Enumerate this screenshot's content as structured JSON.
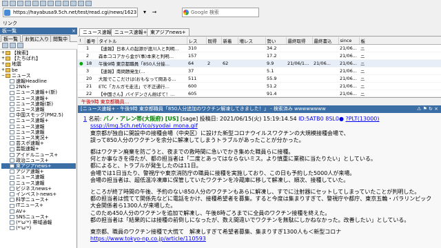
{
  "address": {
    "url": "https://hayabusa9.5ch.net/test/read.cgi/news/1623737954/",
    "search_placeholder": "Google 検索"
  },
  "linkbar": {
    "label": "リンク"
  },
  "left_panel": {
    "title": "板一覧",
    "tabs": [
      "板一覧",
      "お気に入り",
      "閲覧中"
    ],
    "tree": [
      {
        "label": "【検索】",
        "kind": "folder",
        "expander": "+"
      },
      {
        "label": "【たちばれ】",
        "kind": "folder",
        "expander": "+"
      },
      {
        "label": "地震",
        "kind": "folder",
        "expander": "+"
      },
      {
        "label": "be",
        "kind": "folder",
        "expander": "+"
      },
      {
        "label": "ニュース",
        "kind": "folder",
        "expander": "−"
      },
      {
        "label": "速報Headline",
        "kind": "board"
      },
      {
        "label": "2NN+",
        "kind": "board"
      },
      {
        "label": "ニュース速報+(新)",
        "kind": "board"
      },
      {
        "label": "ニュース速報+",
        "kind": "board"
      },
      {
        "label": "ニュース速報(新)",
        "kind": "board"
      },
      {
        "label": "ニュース速報",
        "kind": "board"
      },
      {
        "label": "中国スモッグ(PM2.5)",
        "kind": "board"
      },
      {
        "label": "ニュース速報+",
        "kind": "board"
      },
      {
        "label": "ニュース速報",
        "kind": "board"
      },
      {
        "label": "ニュース速報",
        "kind": "board"
      },
      {
        "label": "ニュース実況+",
        "kind": "board"
      },
      {
        "label": "芸スポ速報+",
        "kind": "board"
      },
      {
        "label": "芸能速報+",
        "kind": "board"
      },
      {
        "label": "アイドルニュース+",
        "kind": "board"
      },
      {
        "label": "政治ニュース+",
        "kind": "board"
      },
      {
        "label": "東アジアnews+",
        "kind": "board",
        "selected": true
      },
      {
        "label": "アジア速報+",
        "kind": "board"
      },
      {
        "label": "ニュース速報",
        "kind": "board"
      },
      {
        "label": "ニュース速報",
        "kind": "board"
      },
      {
        "label": "ビジネスnews+",
        "kind": "board"
      },
      {
        "label": "インベストnews+",
        "kind": "board"
      },
      {
        "label": "科学ニュース+",
        "kind": "board"
      },
      {
        "label": "ITニュース+",
        "kind": "board"
      },
      {
        "label": "AV+",
        "kind": "board"
      },
      {
        "label": "SNSニュース+",
        "kind": "board"
      },
      {
        "label": "(*'ω'*) 帯域通報",
        "kind": "board"
      },
      {
        "label": "(*'ω'*)",
        "kind": "board"
      }
    ]
  },
  "thread_list": {
    "tabs": [
      "ニュース速報",
      "ニュース速報+",
      "東アジアnews+"
    ],
    "columns": [
      "!",
      "番号",
      "タイトル",
      "レス",
      "既得",
      "新着",
      "増レス",
      "勢い",
      "最終取得",
      "最終書込",
      "since",
      "板"
    ],
    "rows": [
      {
        "mark": "",
        "no": "1",
        "title": "【速報】日本人の起源が渡川人と判明…",
        "res": "310",
        "got": "",
        "new": "",
        "inc": "",
        "ikioi": "34.2",
        "last_get": "",
        "last_write": "",
        "since": "21/06...",
        "board": "ニ"
      },
      {
        "mark": "",
        "no": "2",
        "title": "森本ココアから金が(事)本来と判明…",
        "res": "157",
        "got": "",
        "new": "",
        "inc": "",
        "ikioi": "17.2",
        "last_get": "",
        "last_write": "",
        "since": "21/06...",
        "board": "ニ"
      },
      {
        "mark": "●",
        "no": "18",
        "title": "午後9時 東京都職員「850人分接…",
        "res": "64",
        "got": "2",
        "new": "62",
        "inc": "",
        "ikioi": "9.9",
        "last_get": "21/06/1...",
        "last_write": "21/06...",
        "since": "21/06...",
        "board": "ニ",
        "highlight": true
      },
      {
        "mark": "",
        "no": "3",
        "title": "【速報】南問題発生(…",
        "res": "37",
        "got": "",
        "new": "",
        "inc": "",
        "ikioi": "5.1",
        "last_get": "",
        "last_write": "",
        "since": "21/06...",
        "board": "ニ"
      },
      {
        "mark": "",
        "no": "20",
        "title": "大阪でここだけは(おもなって問ある…",
        "res": "511",
        "got": "",
        "new": "",
        "inc": "",
        "ikioi": "55.9",
        "last_get": "",
        "last_write": "",
        "since": "21/06...",
        "board": "ニ"
      },
      {
        "mark": "",
        "no": "21",
        "title": "ETC「カルガモ走法」で不正通行…",
        "res": "600",
        "got": "",
        "new": "",
        "inc": "",
        "ikioi": "51.2",
        "last_get": "",
        "last_write": "",
        "since": "21/06...",
        "board": "ニ"
      },
      {
        "mark": "",
        "no": "22",
        "title": "【中国さん】バイデンさん紛ばて！…",
        "res": "605",
        "got": "",
        "new": "",
        "inc": "",
        "ikioi": "91.4",
        "last_get": "",
        "last_write": "",
        "since": "21/06...",
        "board": "ニ"
      },
      {
        "mark": "",
        "no": "23",
        "title": "「中国共産党の…",
        "res": "590",
        "got": "",
        "new": "",
        "inc": "",
        "ikioi": "80.1",
        "last_get": "",
        "last_write": "",
        "since": "21/06...",
        "board": "ニ"
      }
    ]
  },
  "thread_view": {
    "tabs": [
      "午後9時 東京都職員..."
    ],
    "title": "[ニュース速報+ - 午後9時 東京都職員「850人分追加のワクチン解凍してきました！」 - 検索済み wwwwwwww",
    "post": {
      "number": "1",
      "name_label": "名前:",
      "name": "バノ・アレン帯(大阪府)",
      "region": "[US]",
      "sage": "[sage]",
      "date_label": "投稿日:",
      "date": "2021/06/15(火) 15:19:14.54",
      "id": "ID:5ATB0 8SL0●",
      "be": "?PLT(13000)",
      "icon_url": "sssp://img.5ch.net/ico/syodai_mona.gif",
      "paragraphs": [
        [
          "東京都が独自に開設中の接種会場（中央区）に設けた新型コロナウイルスワクチンの大規模接種会場で、",
          "誤って850人分のワクチンを余分に解凍してしまうトラブルがあったことが分かった。"
        ],
        [
          "都はワクチン廃棄を防ごうと、夜までの救時間に急いでかき集めた職員らに接種。",
          "何とか事なきを得たが、都の担当者は「二度とあってはならないミス。より慎重に業務に当たりたい」としている。",
          "都によると、トラブルが発生したのは11日。",
          "会場では1日当たり、警視庁や東京消防庁の職員に接種を実施しており、この日も予約した5000人が来場。",
          "会場の担当者は、超低温冷凍庫に保管していたワクチンを冷蔵庫に移して解凍し、順次、接種していた。"
        ],
        [
          "ところが終了時間の午後、予約のない850人分のワクチンもあらに解凍し、すでに注射器にセットしてしまっていたことが判明した。",
          "都の担当者は慌てて関係先などに電話をかけ、接種希望者を募集。すると今度は集まりすぎて、警視庁や都庁、東京五輪・パラリンピック",
          "大会関係者ら1300人が来場した。",
          "このため450人分のワクチンを追加で解凍し、午後8時ごろまでに全員のワクチン接種を終えた。",
          "都の担当者は「結果的には接種の前倒しになったが、数え間違いでワクチンを無駄にしかねなかった。改善したい」としている。"
        ],
        [
          "東京都、職員のワクチン接種で大慌て　解凍しすぎて希望者募集、集まりすぎ1300人も＜新型コロナ"
        ]
      ],
      "link": "https://www.tokyo-np.co.jp/article/110593"
    }
  }
}
